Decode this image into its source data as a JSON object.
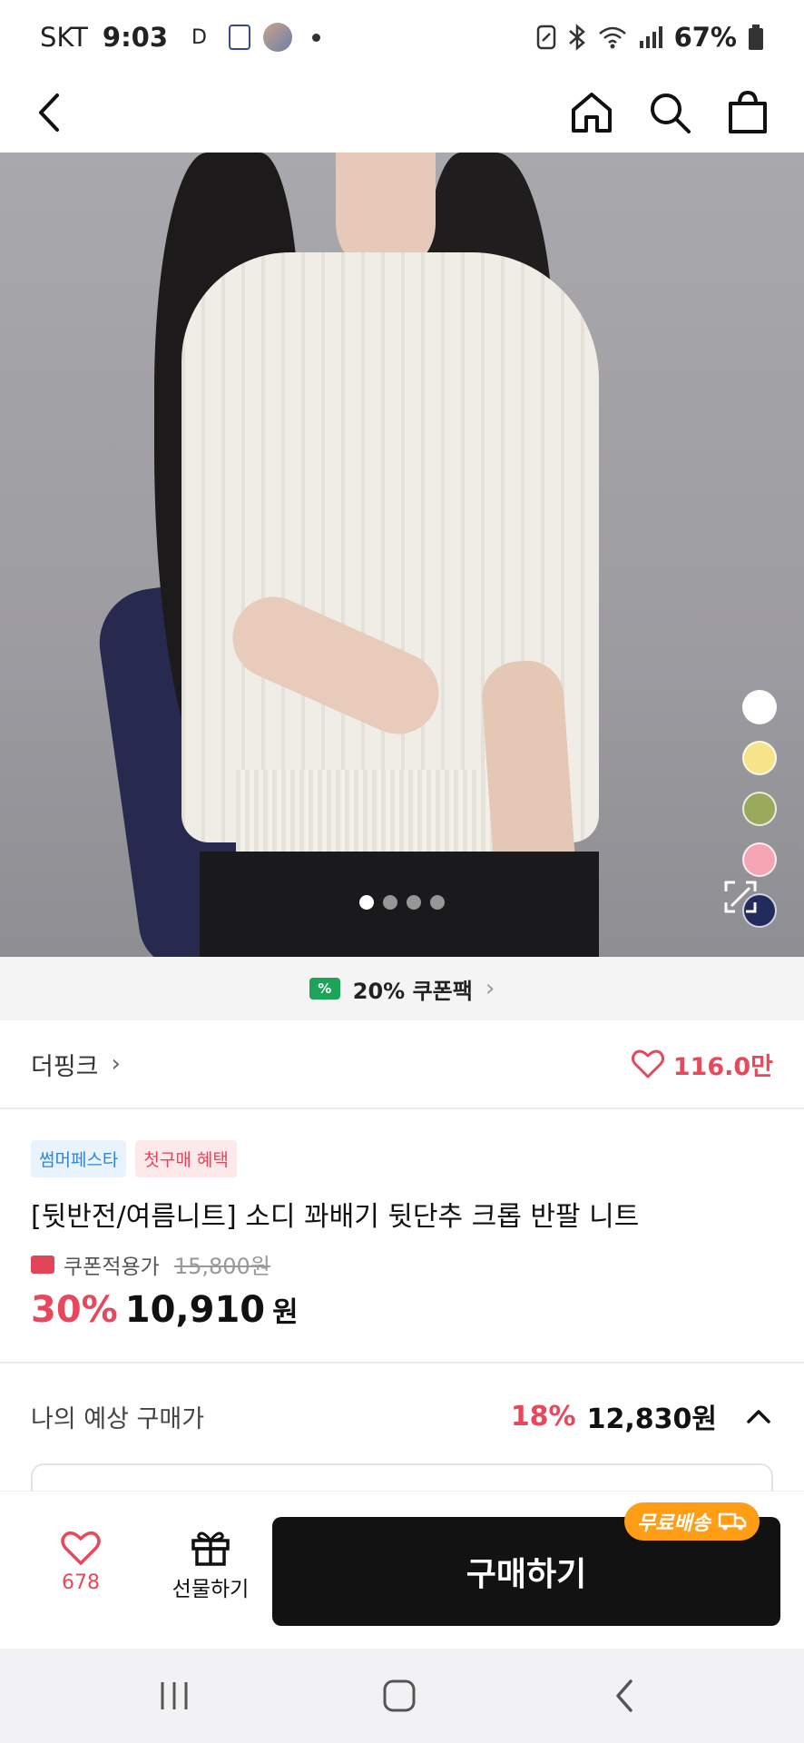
{
  "status_bar": {
    "carrier": "SKT",
    "time": "9:03",
    "indicator": "D",
    "battery": "67%",
    "icons": [
      "app-badge-icon",
      "avatar-icon",
      "notification-dot-icon",
      "nfc-icon",
      "bluetooth-icon",
      "wifi-icon",
      "signal-icon",
      "battery-icon"
    ]
  },
  "nav": {
    "icons": [
      "back-arrow-icon",
      "home-icon",
      "search-icon",
      "shopping-bag-icon"
    ]
  },
  "gallery": {
    "page_count": 4,
    "active_page": 1,
    "swatch_colors": [
      "#ffffff",
      "#f7e38a",
      "#9aaa5c",
      "#f4a6b5",
      "#232a5e"
    ]
  },
  "coupon_pack": {
    "label": "20% 쿠폰팩"
  },
  "brand": {
    "name": "더핑크",
    "likes": "116.0만"
  },
  "product": {
    "badges": [
      "썸머페스타",
      "첫구매 혜택"
    ],
    "title": "[뒷반전/여름니트] 소디 꽈배기 뒷단추 크롭 반팔 니트",
    "coupon_label": "쿠폰적용가",
    "original_price": "15,800원",
    "discount_rate": "30%",
    "sale_price": "10,910",
    "price_unit": "원"
  },
  "estimate": {
    "label": "나의 예상 구매가",
    "rate": "18%",
    "price": "12,830원"
  },
  "bottom_bar": {
    "wish_count": "678",
    "gift_label": "선물하기",
    "buy_label": "구매하기",
    "free_shipping": "무료배송"
  },
  "colors": {
    "accent_red": "#e8485c",
    "coupon_green": "#1ea35a",
    "shipping_orange": "#ff9e15",
    "buy_button": "#121212"
  }
}
